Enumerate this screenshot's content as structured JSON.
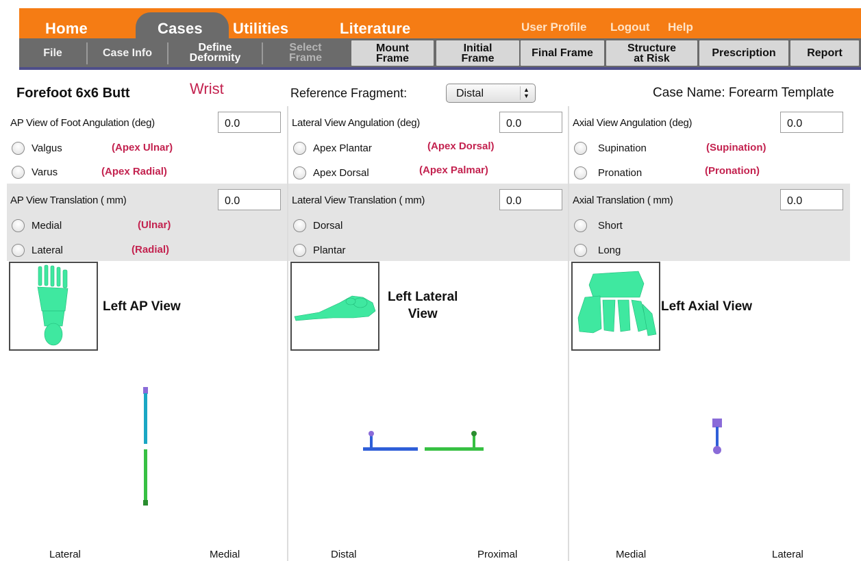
{
  "nav": {
    "home": "Home",
    "cases": "Cases",
    "utilities": "Utilities",
    "literature": "Literature",
    "user_profile": "User Profile",
    "logout": "Logout",
    "help": "Help"
  },
  "subnav": {
    "file": "File",
    "case_info": "Case Info",
    "define_deformity_1": "Define",
    "define_deformity_2": "Deformity",
    "select_frame_1": "Select",
    "select_frame_2": "Frame",
    "mount_frame_1": "Mount",
    "mount_frame_2": "Frame",
    "initial_frame_1": "Initial",
    "initial_frame_2": "Frame",
    "final_frame": "Final Frame",
    "structure_1": "Structure",
    "structure_2": "at Risk",
    "prescription": "Prescription",
    "report": "Report"
  },
  "header": {
    "case_title": "Forefoot 6x6 Butt",
    "wrist": "Wrist",
    "reference_label": "Reference Fragment:",
    "reference_value": "Distal",
    "case_name": "Case Name: Forearm Template"
  },
  "colors": {
    "orange": "#f57c14",
    "nav_gray": "#6b6b6b",
    "hint_red": "#c3224f",
    "bone_green": "#3fe8a0",
    "glyph_blue": "#2f5fd8",
    "glyph_green": "#37c043",
    "glyph_cyan": "#1aa7c4",
    "glyph_purple": "#8a6bd8"
  },
  "panels": {
    "ap": {
      "angulation_label": "AP View of Foot Angulation (deg)",
      "angulation_value": "0.0",
      "opt1": "Valgus",
      "opt1_hint": "(Apex Ulnar)",
      "opt2": "Varus",
      "opt2_hint": "(Apex Radial)",
      "translation_label": "AP View Translation ( mm)",
      "translation_value": "0.0",
      "opt3": "Medial",
      "opt3_hint": "(Ulnar)",
      "opt4": "Lateral",
      "opt4_hint": "(Radial)",
      "view_label": "Left AP View",
      "thumb_icon": "foot-ap-bones-icon",
      "axis_left": "Lateral",
      "axis_right": "Medial"
    },
    "lateral": {
      "angulation_label": "Lateral View Angulation (deg)",
      "angulation_value": "0.0",
      "opt1": "Apex Plantar",
      "opt1_hint": "(Apex Dorsal)",
      "opt2": "Apex Dorsal",
      "opt2_hint": "(Apex Palmar)",
      "translation_label": "Lateral View Translation ( mm)",
      "translation_value": "0.0",
      "opt3": "Dorsal",
      "opt4": "Plantar",
      "view_label_1": "Left Lateral",
      "view_label_2": "View",
      "thumb_icon": "foot-lateral-bones-icon",
      "axis_left": "Distal",
      "axis_right": "Proximal"
    },
    "axial": {
      "angulation_label": "Axial View Angulation (deg)",
      "angulation_value": "0.0",
      "opt1": "Supination",
      "opt1_hint": "(Supination)",
      "opt2": "Pronation",
      "opt2_hint": "(Pronation)",
      "translation_label": "Axial Translation ( mm)",
      "translation_value": "0.0",
      "opt3": "Short",
      "opt4": "Long",
      "view_label": "Left Axial View",
      "thumb_icon": "foot-axial-bones-icon",
      "axis_left": "Medial",
      "axis_right": "Lateral"
    }
  }
}
